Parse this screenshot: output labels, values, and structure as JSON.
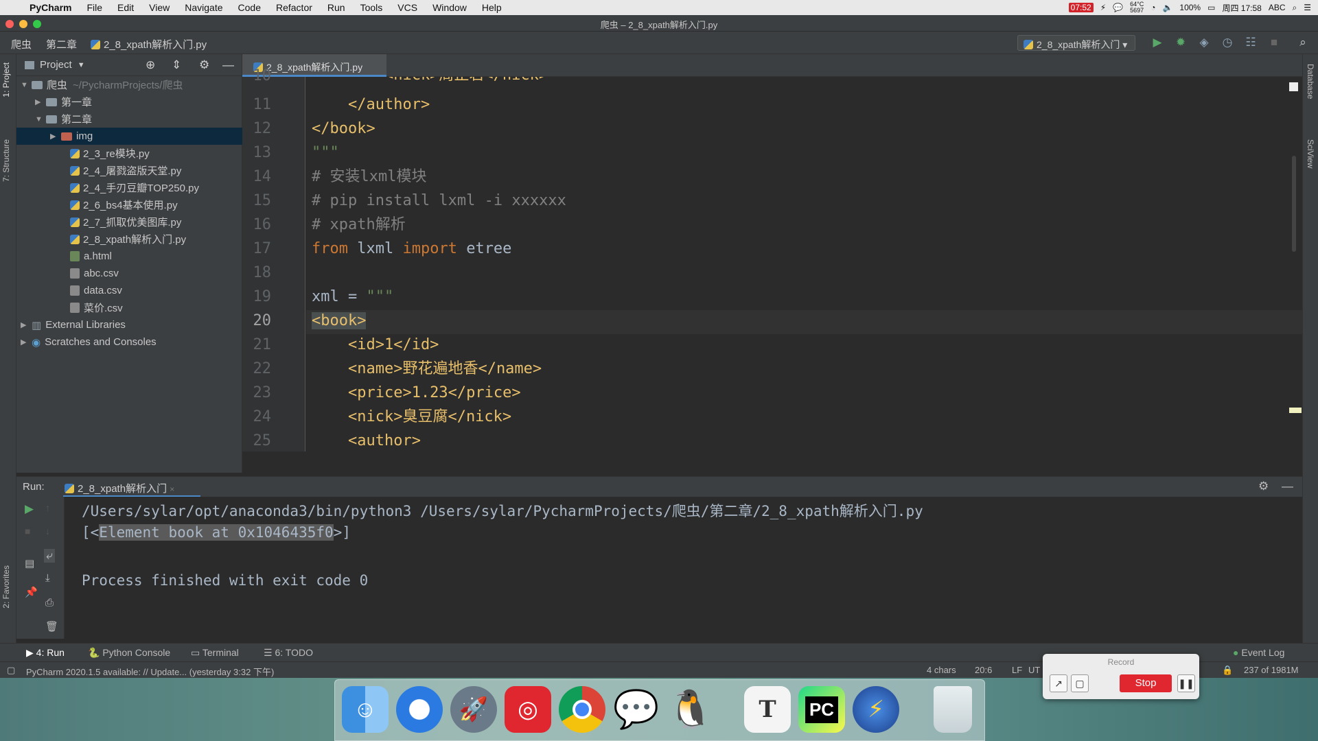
{
  "menubar": {
    "app_name": "PyCharm",
    "items": [
      "File",
      "Edit",
      "View",
      "Navigate",
      "Code",
      "Refactor",
      "Run",
      "Tools",
      "VCS",
      "Window",
      "Help"
    ],
    "status": {
      "record_time": "07:52",
      "cpu_temp": "64°C",
      "cpu_fan": "5697",
      "battery": "100%",
      "clock": "周四 17:58",
      "input_method": "ABC"
    }
  },
  "window": {
    "title": "爬虫 – 2_8_xpath解析入门.py"
  },
  "navbar": {
    "breadcrumbs": [
      "爬虫",
      "第二章",
      "2_8_xpath解析入门.py"
    ],
    "run_config": "2_8_xpath解析入门"
  },
  "side_tabs": {
    "left": [
      "1: Project",
      "7: Structure",
      "2: Favorites"
    ],
    "right": [
      "Database",
      "SciView"
    ]
  },
  "project": {
    "header": "Project",
    "tree": [
      {
        "label": "爬虫",
        "path": "~/PycharmProjects/爬虫",
        "type": "folder",
        "depth": 0,
        "expanded": true
      },
      {
        "label": "第一章",
        "type": "folder",
        "depth": 1,
        "expanded": false
      },
      {
        "label": "第二章",
        "type": "folder",
        "depth": 1,
        "expanded": true
      },
      {
        "label": "img",
        "type": "folder-red",
        "depth": 2,
        "expanded": false
      },
      {
        "label": "2_3_re模块.py",
        "type": "py",
        "depth": 2
      },
      {
        "label": "2_4_屠戮盗版天堂.py",
        "type": "py",
        "depth": 2
      },
      {
        "label": "2_4_手刃豆瓣TOP250.py",
        "type": "py",
        "depth": 2
      },
      {
        "label": "2_6_bs4基本使用.py",
        "type": "py",
        "depth": 2
      },
      {
        "label": "2_7_抓取优美图库.py",
        "type": "py",
        "depth": 2
      },
      {
        "label": "2_8_xpath解析入门.py",
        "type": "py",
        "depth": 2
      },
      {
        "label": "a.html",
        "type": "html",
        "depth": 2
      },
      {
        "label": "abc.csv",
        "type": "csv",
        "depth": 2
      },
      {
        "label": "data.csv",
        "type": "csv",
        "depth": 2
      },
      {
        "label": "菜价.csv",
        "type": "csv",
        "depth": 2
      },
      {
        "label": "External Libraries",
        "type": "lib",
        "depth": 0,
        "expanded": false
      },
      {
        "label": "Scratches and Consoles",
        "type": "scratch",
        "depth": 0,
        "expanded": false
      }
    ]
  },
  "editor": {
    "tab": "2_8_xpath解析入门.py",
    "current_line": "20",
    "lines": [
      {
        "n": "10",
        "text": "        <nick>周正若</nick>",
        "cls": "tag"
      },
      {
        "n": "11",
        "text": "    </author>",
        "cls": "tag"
      },
      {
        "n": "12",
        "text": "</book>",
        "cls": "tag"
      },
      {
        "n": "13",
        "text": "\"\"\"",
        "cls": "str"
      },
      {
        "n": "14",
        "text": "# 安装lxml模块",
        "cls": "cmt"
      },
      {
        "n": "15",
        "text": "# pip install lxml -i xxxxxx",
        "cls": "cmt"
      },
      {
        "n": "16",
        "text": "# xpath解析",
        "cls": "cmt"
      },
      {
        "n": "17",
        "text": "",
        "cls": "code17"
      },
      {
        "n": "18",
        "text": "",
        "cls": "id"
      },
      {
        "n": "19",
        "text": "",
        "cls": "code19"
      },
      {
        "n": "20",
        "text": "<book>",
        "cls": "tag"
      },
      {
        "n": "21",
        "text": "    <id>1</id>",
        "cls": "tag"
      },
      {
        "n": "22",
        "text": "    <name>野花遍地香</name>",
        "cls": "tag"
      },
      {
        "n": "23",
        "text": "    <price>1.23</price>",
        "cls": "tag"
      },
      {
        "n": "24",
        "text": "    <nick>臭豆腐</nick>",
        "cls": "tag"
      },
      {
        "n": "25",
        "text": "    <author>",
        "cls": "tag"
      }
    ],
    "line17": {
      "kw1": "from",
      "mod": " lxml ",
      "kw2": "import",
      "name": " etree"
    },
    "line19": {
      "var": "xml",
      "op": " = ",
      "str": "\"\"\""
    }
  },
  "run": {
    "label": "Run:",
    "tab": "2_8_xpath解析入门",
    "output": [
      "/Users/sylar/opt/anaconda3/bin/python3 /Users/sylar/PycharmProjects/爬虫/第二章/2_8_xpath解析入门.py",
      "[<Element book at 0x1046435f0>]",
      "Process finished with exit code 0"
    ],
    "out_prefix": "[<",
    "out_selected": "Element book at 0x1046435f0",
    "out_suffix": ">]"
  },
  "bottom_tabs": {
    "run": "4: Run",
    "python_console": "Python Console",
    "terminal": "Terminal",
    "todo": "6: TODO",
    "event_log": "Event Log"
  },
  "statusbar": {
    "message": "PyCharm 2020.1.5 available: // Update... (yesterday 3:32 下午)",
    "chars": "4 chars",
    "position": "20:6",
    "line_sep": "LF",
    "encoding": "UT",
    "memory": "237 of 1981M"
  },
  "recorder": {
    "title": "Record",
    "stop_label": "Stop"
  },
  "dock": {
    "apps": [
      "Finder",
      "Safari",
      "Launchpad",
      "NetEase Music",
      "Chrome",
      "WeChat",
      "QQ",
      "Typora",
      "PyCharm",
      "Thunder",
      "Trash"
    ]
  },
  "colors": {
    "accent": "#4a88c7",
    "tag": "#e8bf6a",
    "string": "#6a8759",
    "comment": "#808080",
    "keyword": "#cc7832",
    "stop": "#e0262f"
  }
}
